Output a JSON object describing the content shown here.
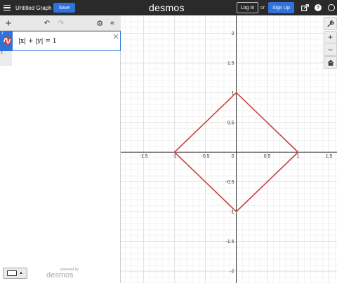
{
  "header": {
    "menu_icon": "hamburger-menu-icon",
    "title": "Untitled Graph",
    "save_label": "Save",
    "logo": "desmos",
    "login_label": "Log In",
    "or_text": "or",
    "signup_label": "Sign Up",
    "icons": [
      "share-icon",
      "help-icon",
      "globe-icon"
    ],
    "help_glyph": "?"
  },
  "toolbar": {
    "add_glyph": "+",
    "undo_glyph": "↶",
    "redo_glyph": "↷",
    "settings_glyph": "⚙",
    "collapse_glyph": "«"
  },
  "expressions": [
    {
      "number": "1",
      "latex": "|x| + |y| = 1",
      "color": "#c74440",
      "delete_glyph": "✕"
    },
    {
      "number": "2",
      "latex": ""
    }
  ],
  "footer": {
    "keyboard_icon": "keyboard-icon",
    "powered_by": "powered by",
    "logo": "desmos"
  },
  "graph_controls": {
    "settings_glyph": "🔧",
    "zoom_in": "+",
    "zoom_out": "−",
    "home_glyph": "⌂"
  },
  "chart_data": {
    "type": "line",
    "x_range": [
      -1.87,
      1.63
    ],
    "y_range": [
      -2.2,
      2.3
    ],
    "x_ticks": [
      "-1.5",
      "-1",
      "-0.5",
      "0",
      "0.5",
      "1",
      "1.5"
    ],
    "y_ticks": [
      "2",
      "1.5",
      "1",
      "0.5",
      "-0.5",
      "-1",
      "-1.5",
      "-2"
    ],
    "grid": true,
    "series": [
      {
        "color": "#c74440",
        "points": [
          [
            1,
            0
          ],
          [
            0,
            1
          ],
          [
            -1,
            0
          ],
          [
            0,
            -1
          ],
          [
            1,
            0
          ]
        ]
      }
    ]
  }
}
